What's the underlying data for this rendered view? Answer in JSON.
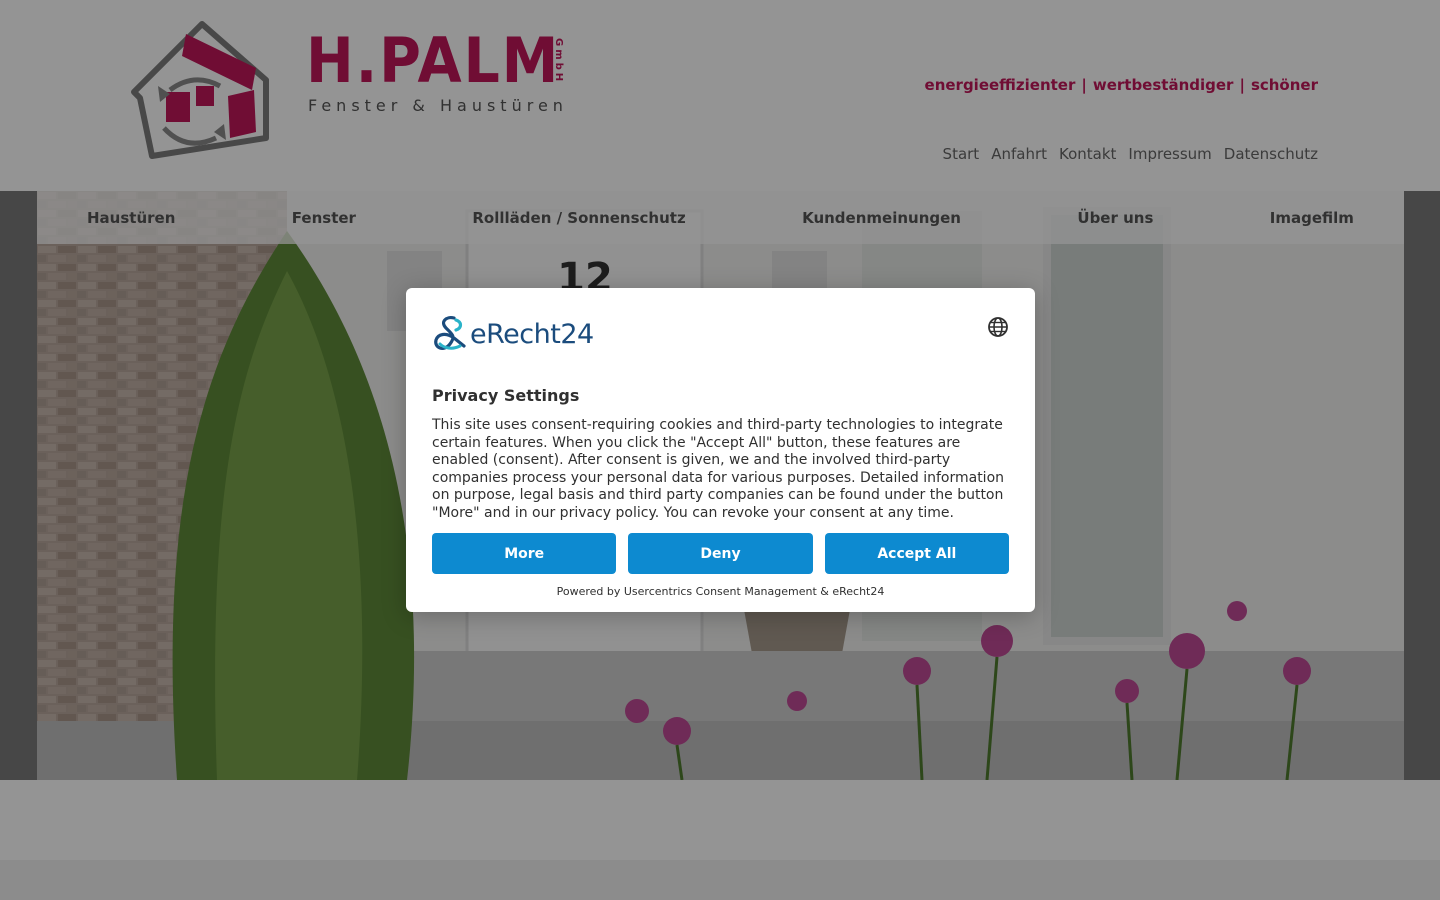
{
  "brand": {
    "name": "H.PALM",
    "legal_form": "GmbH",
    "subtitle": "Fenster & Haustüren"
  },
  "tagline": {
    "items": [
      "energieeffizienter",
      "wertbeständiger",
      "schöner"
    ],
    "separator": "|"
  },
  "topnav": {
    "items": [
      "Start",
      "Anfahrt",
      "Kontakt",
      "Impressum",
      "Datenschutz"
    ]
  },
  "mainnav": {
    "items": [
      "Haustüren",
      "Fenster",
      "Rollläden / Sonnenschutz",
      "Kundenmeinungen",
      "Über uns",
      "Imagefilm"
    ]
  },
  "hero": {
    "house_number": "12"
  },
  "consent": {
    "logo_text": "eRecht24",
    "title": "Privacy Settings",
    "body": "This site uses consent-requiring cookies and third-party technologies to integrate certain features. When you click the \"Accept All\" button, these features are enabled (consent). After consent is given, we and the involved third-party companies process your personal data for various purposes. Detailed information on purpose, legal basis and third party companies can be found under the button \"More\" and in our privacy policy. You can revoke your consent at any time.",
    "buttons": {
      "more": "More",
      "deny": "Deny",
      "accept_all": "Accept All"
    },
    "powered_by": "Powered by Usercentrics Consent Management & eRecht24",
    "language_icon": "globe-icon"
  },
  "colors": {
    "brand": "#c2185b",
    "button": "#0d8ad0",
    "overlay": "rgba(0,0,0,0.42)"
  }
}
